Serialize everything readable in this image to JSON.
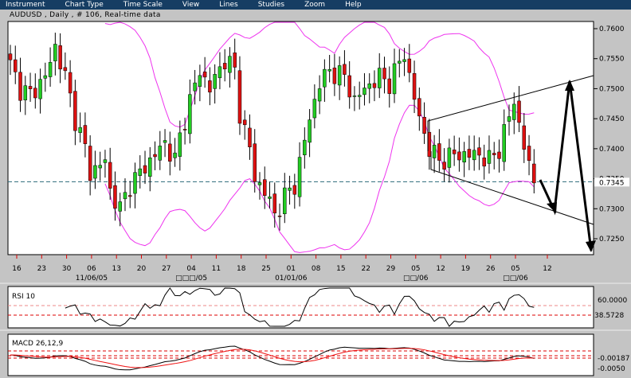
{
  "menu": [
    "Instrument",
    "Chart Type",
    "Time Scale",
    "View",
    "Lines",
    "Studies",
    "Zoom",
    "Help"
  ],
  "title": "AUDUSD , Daily , # 106, Real-time data",
  "price_axis": [
    "0.7600",
    "0.7550",
    "0.7500",
    "0.7450",
    "0.7400",
    "0.7350",
    "0.7300",
    "0.7250"
  ],
  "price_axis_values": [
    0.76,
    0.755,
    0.75,
    0.745,
    0.74,
    0.735,
    0.73,
    0.725
  ],
  "current_price": "0.7345",
  "current_price_value": 0.7345,
  "date_ticks": [
    "16",
    "23",
    "30",
    "06",
    "13",
    "20",
    "27",
    "04",
    "11",
    "18",
    "25",
    "01",
    "08",
    "15",
    "22",
    "29",
    "05",
    "12",
    "19",
    "26",
    "05",
    "12"
  ],
  "month_labels": [
    {
      "text": "11/06/05",
      "tick": 3
    },
    {
      "text": "□□□/05",
      "tick": 7
    },
    {
      "text": "01/01/06",
      "tick": 11
    },
    {
      "text": "□□/06",
      "tick": 16
    },
    {
      "text": "□□/06",
      "tick": 20
    }
  ],
  "rsi": {
    "label": "RSI 10",
    "level": "60.0000",
    "value": "38.5728"
  },
  "macd": {
    "label": "MACD 26,12,9",
    "value": "-0.00187",
    "level": "-0.0050"
  },
  "colors": {
    "menu": "#163d63",
    "bull": "#22cc22",
    "bear": "#dd1111",
    "band": "#ee33ee",
    "signal": "#ee1111",
    "accent": "#ff0000"
  },
  "close_anchors": [
    [
      0,
      0.754
    ],
    [
      2,
      0.75
    ],
    [
      4,
      0.749
    ],
    [
      7,
      0.752
    ],
    [
      9,
      0.757
    ],
    [
      11,
      0.752
    ],
    [
      13,
      0.745
    ],
    [
      15,
      0.74
    ],
    [
      16,
      0.736
    ],
    [
      19,
      0.738
    ],
    [
      20,
      0.733
    ],
    [
      22,
      0.73
    ],
    [
      24,
      0.734
    ],
    [
      26,
      0.736
    ],
    [
      29,
      0.739
    ],
    [
      31,
      0.741
    ],
    [
      33,
      0.738
    ],
    [
      34,
      0.742
    ],
    [
      36,
      0.748
    ],
    [
      38,
      0.753
    ],
    [
      40,
      0.75
    ],
    [
      43,
      0.755
    ],
    [
      45,
      0.753
    ],
    [
      46,
      0.746
    ],
    [
      48,
      0.74
    ],
    [
      49,
      0.735
    ],
    [
      51,
      0.733
    ],
    [
      53,
      0.729
    ],
    [
      55,
      0.732
    ],
    [
      57,
      0.734
    ],
    [
      60,
      0.745
    ],
    [
      62,
      0.751
    ],
    [
      64,
      0.753
    ],
    [
      67,
      0.752
    ],
    [
      69,
      0.748
    ],
    [
      71,
      0.75
    ],
    [
      74,
      0.752
    ],
    [
      76,
      0.751
    ],
    [
      79,
      0.756
    ],
    [
      80,
      0.752
    ],
    [
      82,
      0.745
    ],
    [
      84,
      0.74
    ],
    [
      86,
      0.738
    ],
    [
      89,
      0.739
    ],
    [
      91,
      0.739
    ],
    [
      94,
      0.739
    ],
    [
      96,
      0.738
    ],
    [
      98,
      0.74
    ],
    [
      101,
      0.748
    ],
    [
      102,
      0.744
    ],
    [
      104,
      0.737
    ],
    [
      105,
      0.7345
    ]
  ]
}
